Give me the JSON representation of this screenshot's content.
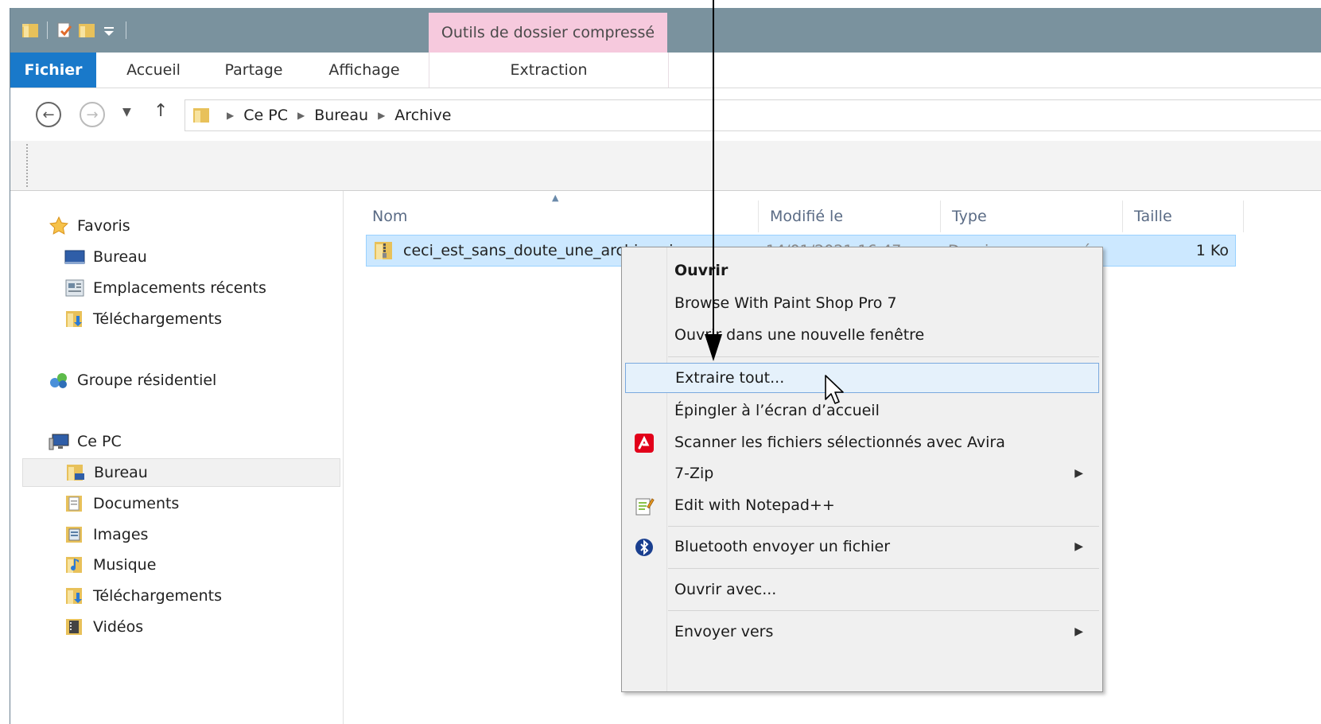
{
  "ribbon": {
    "contextual_tab": "Outils de dossier compressé",
    "tabs": [
      "Fichier",
      "Accueil",
      "Partage",
      "Affichage"
    ],
    "contextual_subtab": "Extraction"
  },
  "address": {
    "crumbs": [
      "Ce PC",
      "Bureau",
      "Archive"
    ]
  },
  "nav": {
    "favorites": "Favoris",
    "favorites_items": [
      "Bureau",
      "Emplacements récents",
      "Téléchargements"
    ],
    "homegroup": "Groupe résidentiel",
    "thispc": "Ce PC",
    "thispc_items": [
      "Bureau",
      "Documents",
      "Images",
      "Musique",
      "Téléchargements",
      "Vidéos"
    ]
  },
  "columns": {
    "name": "Nom",
    "modified": "Modifié le",
    "type": "Type",
    "size": "Taille"
  },
  "file": {
    "name": "ceci_est_sans_doute_une_archive.zip",
    "modified": "14/01/2021 16:47",
    "type": "Dossier compressé",
    "size": "1 Ko"
  },
  "context_menu": {
    "open": "Ouvrir",
    "browse_psp": "Browse With Paint Shop Pro 7",
    "open_new_window": "Ouvrir dans une nouvelle fenêtre",
    "extract_all": "Extraire tout...",
    "pin_start": "Épingler à l’écran d’accueil",
    "scan_avira": "Scanner les fichiers sélectionnés avec Avira",
    "seven_zip": "7-Zip",
    "edit_notepad": "Edit with Notepad++",
    "bluetooth": "Bluetooth envoyer un fichier",
    "open_with": "Ouvrir avec...",
    "send_to": "Envoyer vers"
  },
  "colors": {
    "file_tab": "#1979ca",
    "contextual_tab": "#f6c9dd",
    "selection": "#cce8ff",
    "menu_highlight": "#e5f1fb",
    "avira": "#e2001a"
  }
}
